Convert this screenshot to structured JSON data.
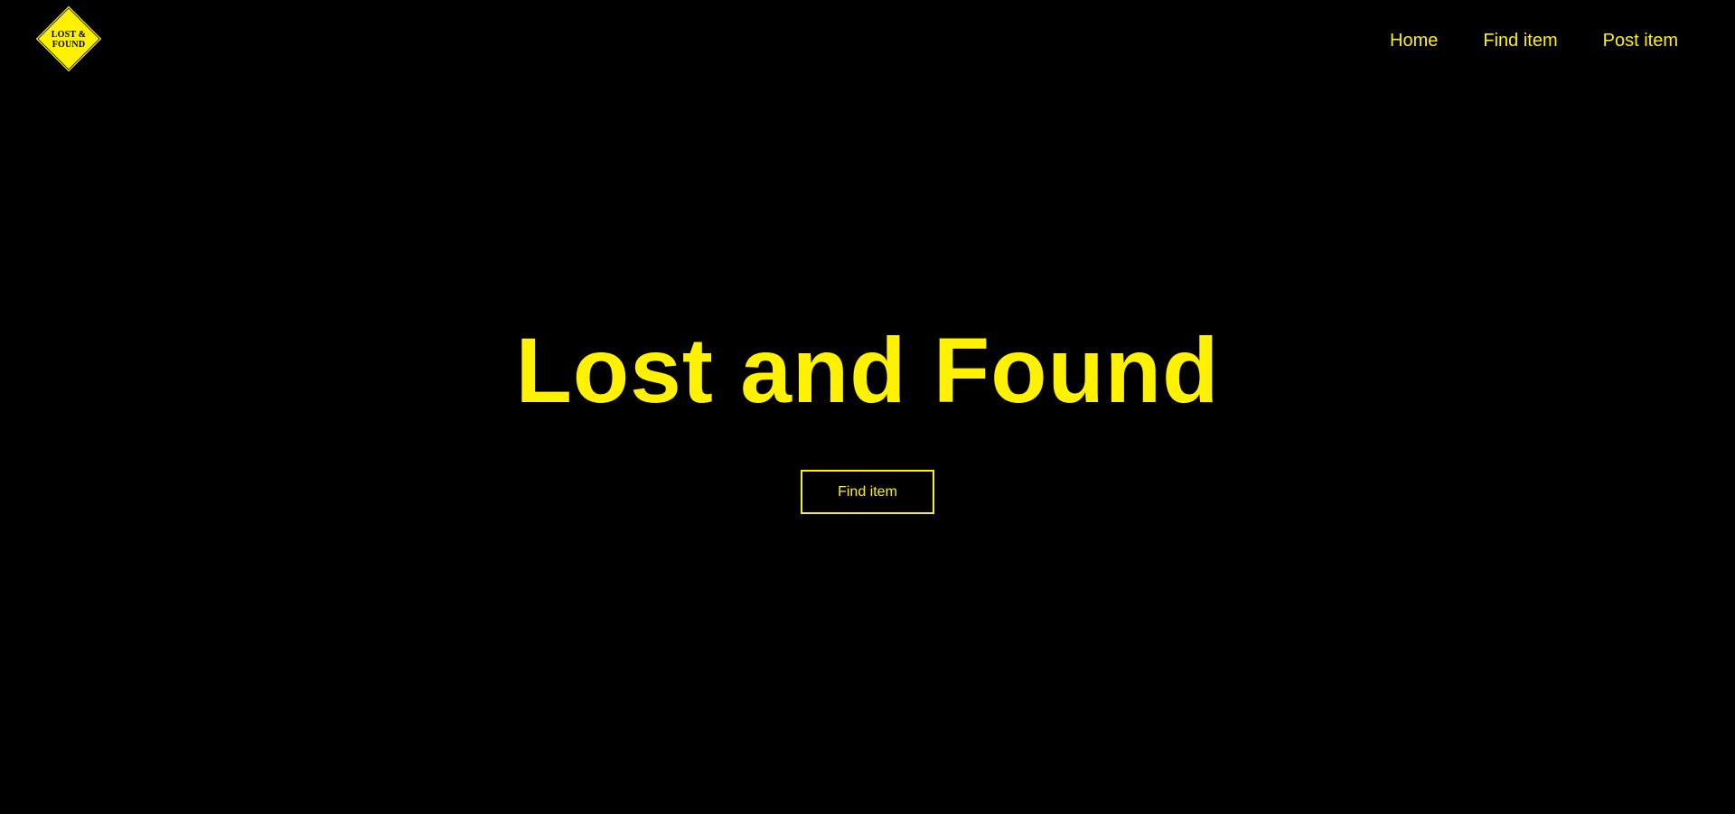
{
  "colors": {
    "background": "#000000",
    "accent": "#FFF200",
    "logo_text": "#000000"
  },
  "logo": {
    "icon": "diamond-sign-icon",
    "line1": "LOST &",
    "line2": "FOUND"
  },
  "nav": {
    "items": [
      {
        "label": "Home"
      },
      {
        "label": "Find item"
      },
      {
        "label": "Post item"
      }
    ]
  },
  "hero": {
    "title": "Lost and Found",
    "button_label": "Find item"
  }
}
